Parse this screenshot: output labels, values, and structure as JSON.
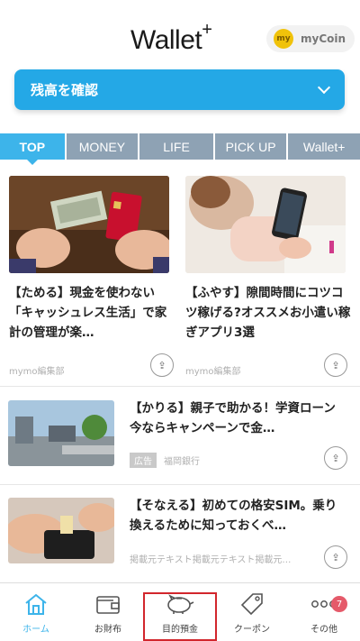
{
  "header": {
    "logo": "Wallet",
    "logo_sup": "+",
    "mycoin_icon": "my",
    "mycoin_label": "myCoin"
  },
  "balance": {
    "label": "残高を確認",
    "icon": "chevron-down-icon"
  },
  "tabs": [
    {
      "label": "TOP",
      "active": true
    },
    {
      "label": "MONEY",
      "active": false
    },
    {
      "label": "LIFE",
      "active": false
    },
    {
      "label": "PICK UP",
      "active": false
    },
    {
      "label": "Wallet+",
      "active": false
    }
  ],
  "articles": [
    {
      "title": "【ためる】現金を使わない「キャッシュレス生活」で家計の管理が楽…",
      "source": "mymo編集部"
    },
    {
      "title": "【ふやす】隙間時間にコツコツ稼げる?オススメお小遣い稼ぎアプリ3選",
      "source": "mymo編集部"
    },
    {
      "title": "【かりる】親子で助かる！学資ローン今ならキャンペーンで金…",
      "ad_label": "広告",
      "source": "福岡銀行"
    },
    {
      "title": "【そなえる】初めての格安SIM。乗り換えるために知っておくべ…",
      "source": "掲載元テキスト掲載元テキスト掲載元…"
    }
  ],
  "nav": [
    {
      "label": "ホーム",
      "icon": "home-icon",
      "active": true
    },
    {
      "label": "お財布",
      "icon": "wallet-icon",
      "active": false
    },
    {
      "label": "目的預金",
      "icon": "piggy-bank-icon",
      "active": false
    },
    {
      "label": "クーポン",
      "icon": "coupon-tag-icon",
      "active": false
    },
    {
      "label": "その他",
      "icon": "more-icon",
      "active": false,
      "badge": "7"
    }
  ],
  "colors": {
    "accent": "#3db4ea",
    "tab_inactive": "#8ea2b4",
    "highlight": "#d2262c",
    "badge": "#e55a6a"
  }
}
